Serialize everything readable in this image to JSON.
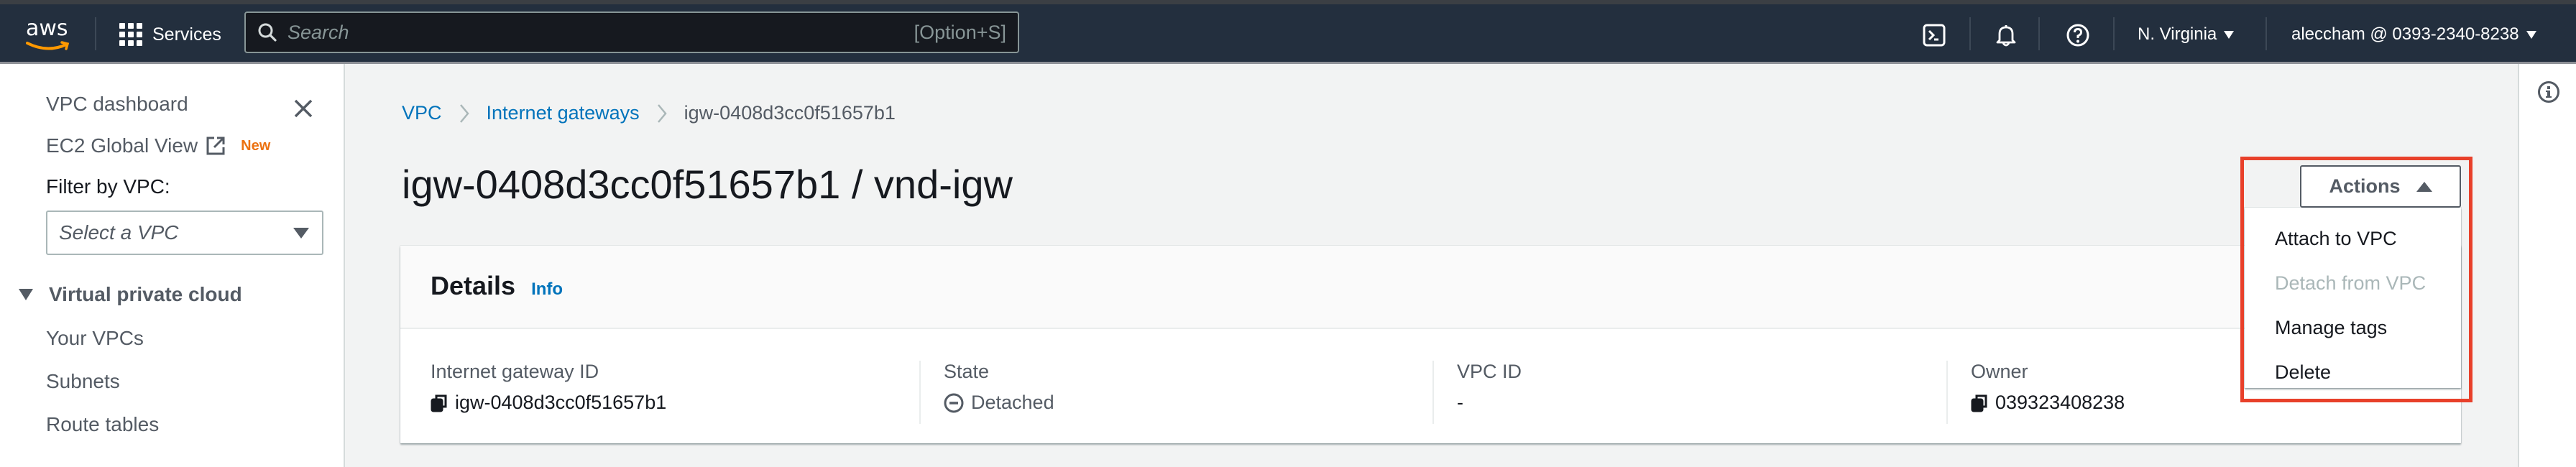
{
  "topnav": {
    "logo": "aws",
    "services_label": "Services",
    "search_placeholder": "Search",
    "search_value": "",
    "search_shortcut": "[Option+S]",
    "icons": [
      "cloudshell-icon",
      "notifications-bell-icon",
      "help-icon"
    ],
    "region": "N. Virginia",
    "account": "aleccham @ 0393-2340-8238"
  },
  "sidebar": {
    "items_top": [
      {
        "label": "VPC dashboard"
      },
      {
        "label": "EC2 Global View",
        "badge": "New",
        "external": true
      }
    ],
    "filter_label": "Filter by VPC:",
    "filter_placeholder": "Select a VPC",
    "section": {
      "label": "Virtual private cloud",
      "expanded": true,
      "items": [
        {
          "label": "Your VPCs"
        },
        {
          "label": "Subnets"
        },
        {
          "label": "Route tables"
        }
      ]
    }
  },
  "breadcrumb": [
    {
      "label": "VPC",
      "link": true
    },
    {
      "label": "Internet gateways",
      "link": true
    },
    {
      "label": "igw-0408d3cc0f51657b1",
      "link": false
    }
  ],
  "page": {
    "title": "igw-0408d3cc0f51657b1 / vnd-igw"
  },
  "actions": {
    "label": "Actions",
    "expanded": true,
    "menu": [
      {
        "label": "Attach to VPC",
        "disabled": false
      },
      {
        "label": "Detach from VPC",
        "disabled": true
      },
      {
        "label": "Manage tags",
        "disabled": false
      },
      {
        "label": "Delete",
        "disabled": false
      }
    ],
    "highlight_color": "#e8402a"
  },
  "details": {
    "title": "Details",
    "info_label": "Info",
    "fields": [
      {
        "label": "Internet gateway ID",
        "value": "igw-0408d3cc0f51657b1",
        "copyable": true
      },
      {
        "label": "State",
        "value": "Detached",
        "status_icon": "detached-minus-circle-icon"
      },
      {
        "label": "VPC ID",
        "value": "-"
      },
      {
        "label": "Owner",
        "value": "039323408238",
        "copyable": true
      }
    ]
  },
  "colors": {
    "nav_bg": "#232f3e",
    "link": "#0073bb",
    "badge_new": "#ec7211",
    "text_secondary": "#545b64"
  }
}
